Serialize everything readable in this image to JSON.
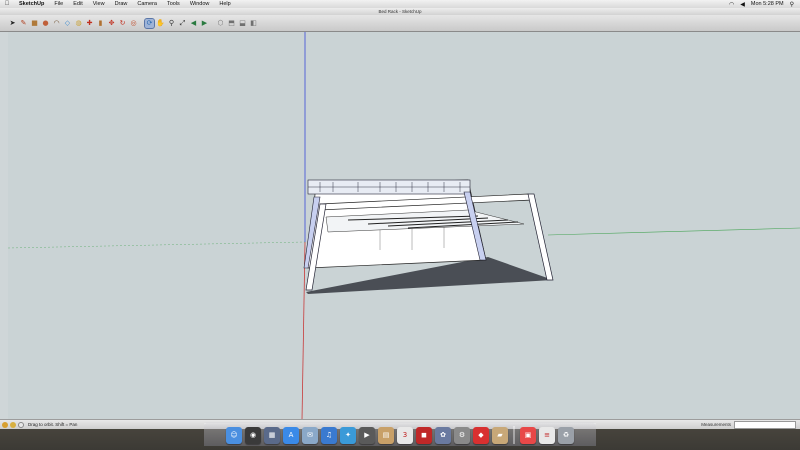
{
  "menubar": {
    "apple": "",
    "items": [
      "SketchUp",
      "File",
      "Edit",
      "View",
      "Draw",
      "Camera",
      "Tools",
      "Window",
      "Help"
    ],
    "clock": "Mon 5:28 PM"
  },
  "window": {
    "title": "Bed Rack - SketchUp"
  },
  "toolbar": {
    "tools": [
      {
        "name": "select-tool",
        "glyph": "➤",
        "color": "#222222"
      },
      {
        "name": "line-tool",
        "glyph": "✎",
        "color": "#b04020"
      },
      {
        "name": "rectangle-tool",
        "glyph": "■",
        "color": "#b07a3a"
      },
      {
        "name": "circle-tool",
        "glyph": "●",
        "color": "#c0603a"
      },
      {
        "name": "arc-tool",
        "glyph": "◠",
        "color": "#6a4a2a"
      },
      {
        "name": "eraser-tool",
        "glyph": "◇",
        "color": "#3a8ad0"
      },
      {
        "name": "tape-measure-tool",
        "glyph": "◍",
        "color": "#c9a030"
      },
      {
        "name": "paint-bucket-tool",
        "glyph": "✚",
        "color": "#c03020"
      },
      {
        "name": "push-pull-tool",
        "glyph": "▮",
        "color": "#b07030"
      },
      {
        "name": "move-tool",
        "glyph": "✥",
        "color": "#c03020"
      },
      {
        "name": "rotate-tool",
        "glyph": "↻",
        "color": "#c03020"
      },
      {
        "name": "offset-tool",
        "glyph": "◎",
        "color": "#c05030"
      },
      {
        "name": "orbit-tool",
        "glyph": "⟳",
        "color": "#2a6ab0"
      },
      {
        "name": "pan-tool",
        "glyph": "✋",
        "color": "#a07040"
      },
      {
        "name": "zoom-tool",
        "glyph": "⚲",
        "color": "#333333"
      },
      {
        "name": "zoom-extents-tool",
        "glyph": "⤢",
        "color": "#333333"
      },
      {
        "name": "previous-view-tool",
        "glyph": "◀",
        "color": "#2a7a40"
      },
      {
        "name": "next-view-tool",
        "glyph": "▶",
        "color": "#2a7a40"
      },
      {
        "name": "iso-view-tool",
        "glyph": "⬡",
        "color": "#707070"
      },
      {
        "name": "top-view-tool",
        "glyph": "⬒",
        "color": "#707070"
      },
      {
        "name": "front-view-tool",
        "glyph": "⬓",
        "color": "#707070"
      },
      {
        "name": "right-view-tool",
        "glyph": "◧",
        "color": "#707070"
      }
    ],
    "selected_tool": "orbit-tool"
  },
  "status": {
    "hint": "Drag to orbit.  Shift = Pan",
    "measurements_label": "Measurements",
    "measurements_value": ""
  },
  "dock": {
    "apps": [
      {
        "name": "finder-icon",
        "glyph": "☺",
        "color": "#4a8fe0"
      },
      {
        "name": "dashboard-icon",
        "glyph": "◉",
        "color": "#3a3a3a"
      },
      {
        "name": "mission-control-icon",
        "glyph": "▦",
        "color": "#5a6a8a"
      },
      {
        "name": "app-store-icon",
        "glyph": "A",
        "color": "#3a8ae8"
      },
      {
        "name": "mail-icon",
        "glyph": "✉",
        "color": "#8aa8c8"
      },
      {
        "name": "itunes-icon",
        "glyph": "♫",
        "color": "#3a7ad0"
      },
      {
        "name": "safari-icon",
        "glyph": "✦",
        "color": "#3a9ad8"
      },
      {
        "name": "facetime-icon",
        "glyph": "▶",
        "color": "#5a5a5a"
      },
      {
        "name": "preview-icon",
        "glyph": "▤",
        "color": "#c8a068"
      },
      {
        "name": "calendar-icon",
        "glyph": "3",
        "color": "#e8e8e8"
      },
      {
        "name": "photo-booth-icon",
        "glyph": "◼",
        "color": "#c02828"
      },
      {
        "name": "iphoto-icon",
        "glyph": "✿",
        "color": "#6a7aa0"
      },
      {
        "name": "system-preferences-icon",
        "glyph": "⚙",
        "color": "#8a8a8a"
      },
      {
        "name": "sketchup-icon",
        "glyph": "◆",
        "color": "#d83030"
      },
      {
        "name": "documents-folder-icon",
        "glyph": "▰",
        "color": "#c8a878"
      },
      {
        "name": "layout-icon",
        "glyph": "▣",
        "color": "#e84848"
      },
      {
        "name": "text-document-icon",
        "glyph": "≡",
        "color": "#e8e8e8"
      },
      {
        "name": "trash-icon",
        "glyph": "♻",
        "color": "#9aa0a8"
      }
    ]
  },
  "colors": {
    "axis_blue": "#3a4ad8",
    "axis_green": "#2a9a3a",
    "axis_red": "#c83a3a",
    "viewport_background": "#cad3d5",
    "model_shadow": "#4a4e55"
  }
}
